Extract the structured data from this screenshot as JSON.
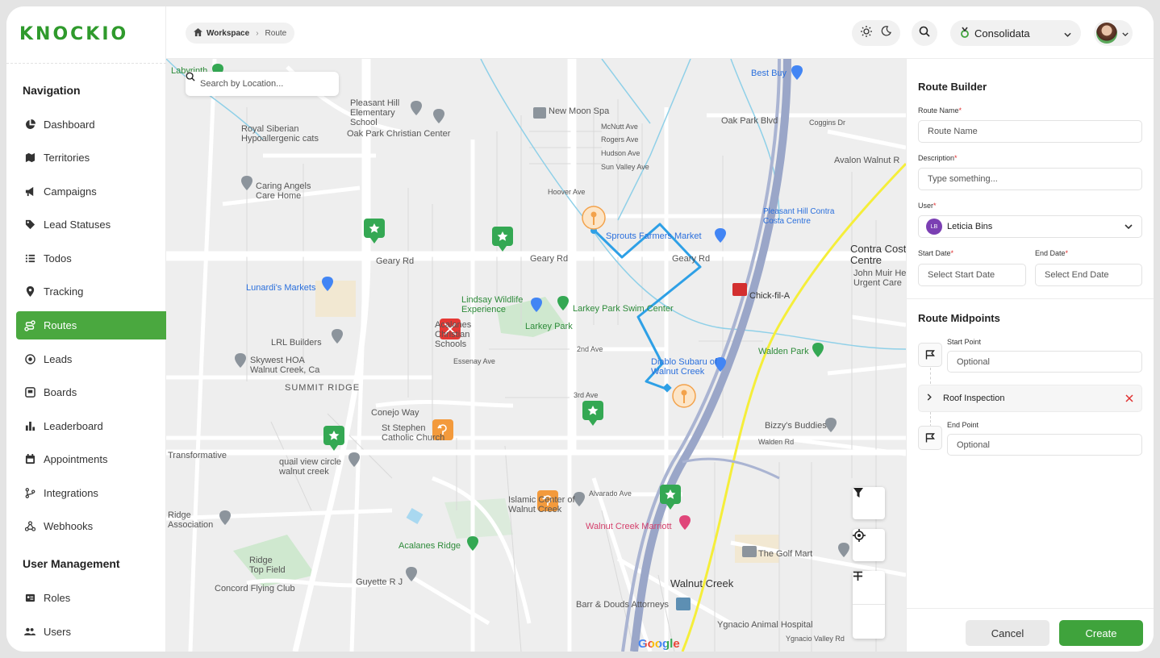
{
  "app": {
    "logo_text": "KNOCKIO",
    "brand_color": "#3fa33c"
  },
  "sidebar": {
    "nav_title": "Navigation",
    "items": [
      {
        "label": "Dashboard",
        "icon": "pie-chart-icon"
      },
      {
        "label": "Territories",
        "icon": "map-icon"
      },
      {
        "label": "Campaigns",
        "icon": "megaphone-icon"
      },
      {
        "label": "Lead Statuses",
        "icon": "tag-icon"
      },
      {
        "label": "Todos",
        "icon": "list-icon"
      },
      {
        "label": "Tracking",
        "icon": "pin-icon"
      },
      {
        "label": "Routes",
        "icon": "route-icon",
        "active": true
      },
      {
        "label": "Leads",
        "icon": "target-icon"
      },
      {
        "label": "Boards",
        "icon": "board-icon"
      },
      {
        "label": "Leaderboard",
        "icon": "bar-chart-icon"
      },
      {
        "label": "Appointments",
        "icon": "calendar-icon"
      },
      {
        "label": "Integrations",
        "icon": "branch-icon"
      },
      {
        "label": "Webhooks",
        "icon": "webhook-icon"
      }
    ],
    "user_mgmt_title": "User Management",
    "user_items": [
      {
        "label": "Roles",
        "icon": "id-card-icon"
      },
      {
        "label": "Users",
        "icon": "users-icon"
      }
    ]
  },
  "topbar": {
    "breadcrumb": [
      "Workspace",
      "Route"
    ],
    "org_name": "Consolidata"
  },
  "map": {
    "search_placeholder": "Search by Location...",
    "labels": [
      "Labyrinth",
      "Pleasant Hill Elementary School",
      "New Moon Spa",
      "Best Buy",
      "McNutt Ave",
      "Rogers Ave",
      "Hudson Ave",
      "Sun Valley Ave",
      "Royal Siberian Hypoallergenic cats",
      "Oak Park Christian Center",
      "Oak Park Blvd",
      "Coggins Dr",
      "Avalon Walnut R",
      "Caring Angels Care Home",
      "Hoover Ave",
      "Sprouts Farmers Market",
      "Pleasant Hill Contra Costa Centre",
      "Contra Costa Centre",
      "Geary Rd",
      "Geary Rd",
      "Geary Rd",
      "John Muir He Urgent Care",
      "Lunardi's Markets",
      "Chick-fil-A",
      "Lindsay Wildlife Experience",
      "Larkey Park Swim Center",
      "Larkey Park",
      "Acalanes Christian Schools",
      "LRL Builders",
      "Skywest HOA Walnut Creek, Ca",
      "2nd Ave",
      "Diablo Subaru of Walnut Creek",
      "Walden Park",
      "Essenay Ave",
      "SUMMIT RIDGE",
      "3rd Ave",
      "Conejo Way",
      "St Stephen Catholic Church",
      "Bizzy's Buddies",
      "Walden Rd",
      "Transformative",
      "quail view circle walnut creek",
      "Alvarado Ave",
      "Islamic Center of Walnut Creek",
      "Ridge Association",
      "Walnut Creek Marriott",
      "Acalanes Ridge",
      "The Golf Mart",
      "Ridge Top Field",
      "Concord Flying Club",
      "Guyette R J",
      "Walnut Creek",
      "Barr & Douds Attorneys",
      "Ygnacio Animal Hospital",
      "Ygnacio Valley Rd"
    ],
    "google_text": "Google"
  },
  "route_builder": {
    "title": "Route Builder",
    "route_name_label": "Route Name",
    "route_name_placeholder": "Route Name",
    "description_label": "Description",
    "description_placeholder": "Type something...",
    "user_label": "User",
    "user_initials": "LB",
    "user_name": "Leticia Bins",
    "start_date_label": "Start Date",
    "start_date_placeholder": "Select Start Date",
    "end_date_label": "End Date",
    "end_date_placeholder": "Select End Date",
    "required_mark": "*"
  },
  "midpoints": {
    "title": "Route Midpoints",
    "start_label": "Start Point",
    "start_placeholder": "Optional",
    "item_name": "Roof Inspection",
    "end_label": "End Point",
    "end_placeholder": "Optional"
  },
  "actions": {
    "cancel_label": "Cancel",
    "create_label": "Create"
  }
}
